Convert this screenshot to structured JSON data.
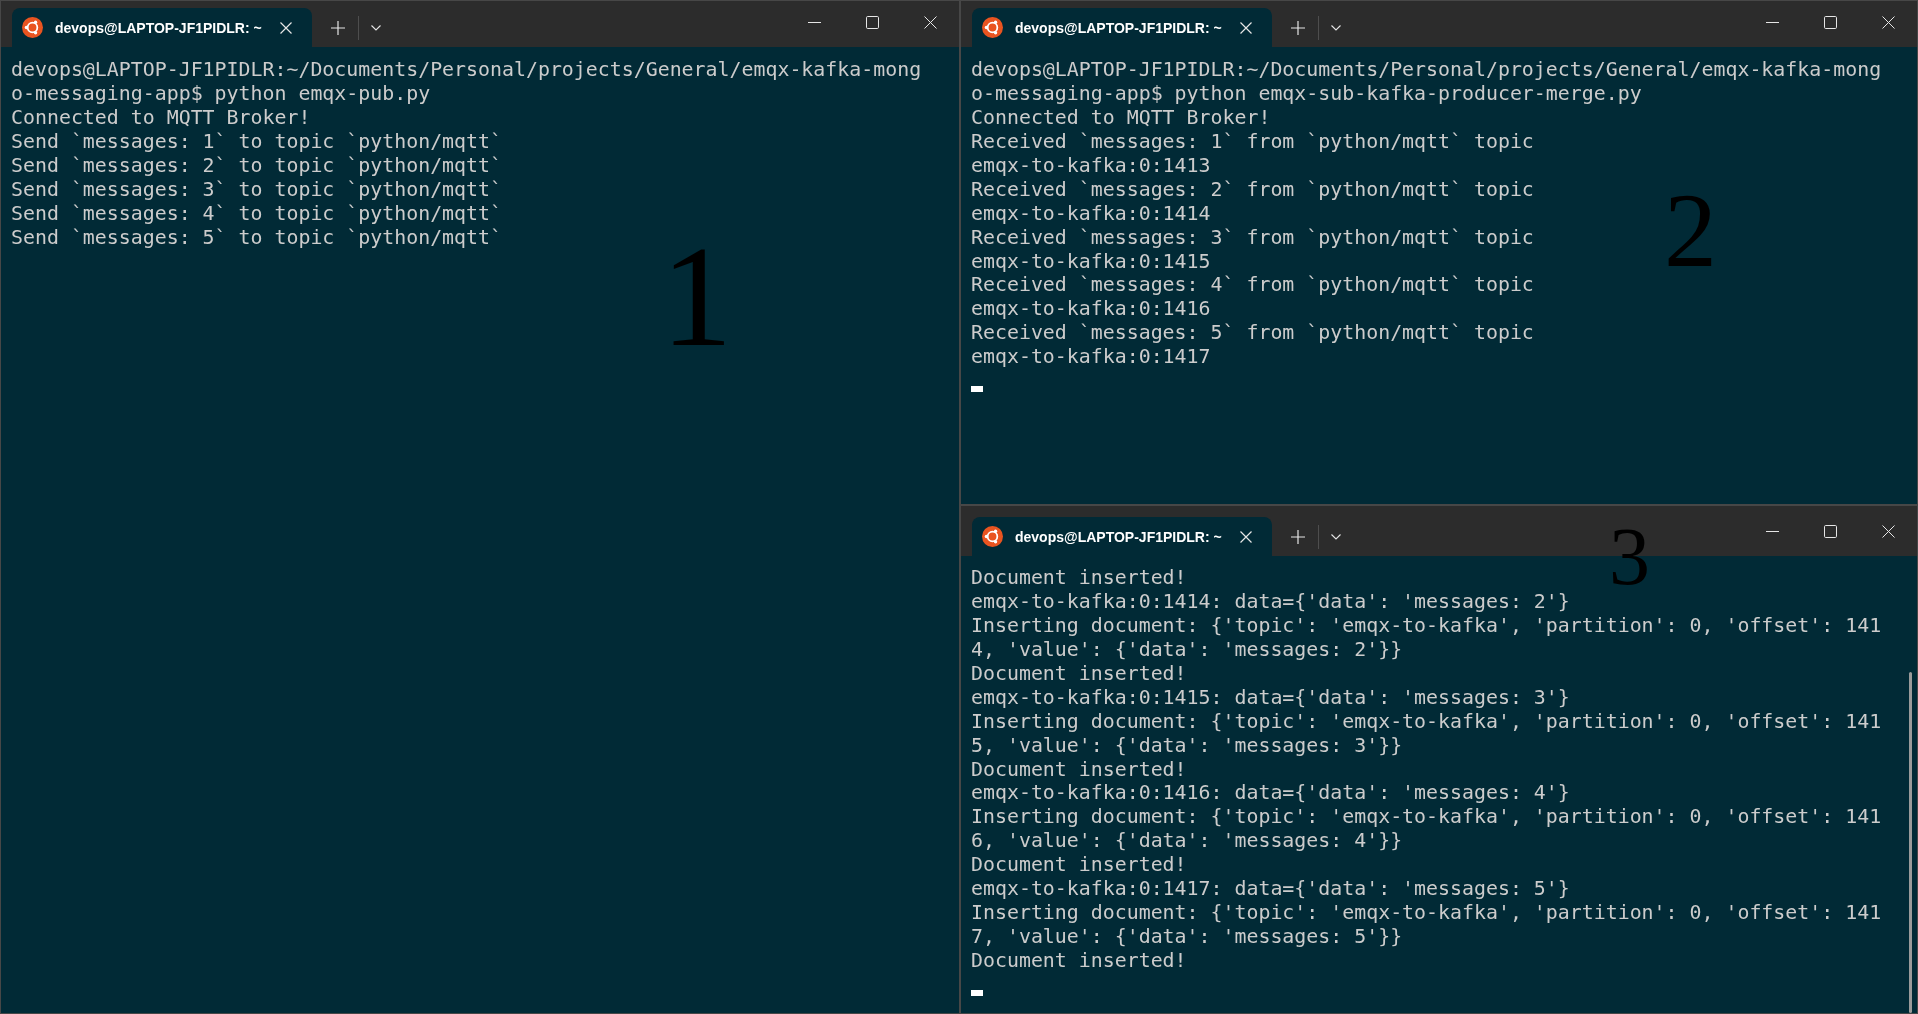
{
  "windows": [
    {
      "tab": {
        "title": "devops@LAPTOP-JF1PIDLR: ~",
        "selected": true
      },
      "lines": [
        "devops@LAPTOP-JF1PIDLR:~/Documents/Personal/projects/General/emqx-kafka-mong",
        "o-messaging-app$ python emqx-pub.py",
        "Connected to MQTT Broker!",
        "Send `messages: 1` to topic `python/mqtt`",
        "Send `messages: 2` to topic `python/mqtt`",
        "Send `messages: 3` to topic `python/mqtt`",
        "Send `messages: 4` to topic `python/mqtt`",
        "Send `messages: 5` to topic `python/mqtt`"
      ],
      "cursor": false,
      "scrollbar": false,
      "annotation": "1"
    },
    {
      "tab": {
        "title": "devops@LAPTOP-JF1PIDLR: ~",
        "selected": true
      },
      "lines": [
        "devops@LAPTOP-JF1PIDLR:~/Documents/Personal/projects/General/emqx-kafka-mong",
        "o-messaging-app$ python emqx-sub-kafka-producer-merge.py",
        "Connected to MQTT Broker!",
        "Received `messages: 1` from `python/mqtt` topic",
        "emqx-to-kafka:0:1413",
        "Received `messages: 2` from `python/mqtt` topic",
        "emqx-to-kafka:0:1414",
        "Received `messages: 3` from `python/mqtt` topic",
        "emqx-to-kafka:0:1415",
        "Received `messages: 4` from `python/mqtt` topic",
        "emqx-to-kafka:0:1416",
        "Received `messages: 5` from `python/mqtt` topic",
        "emqx-to-kafka:0:1417"
      ],
      "cursor": true,
      "scrollbar": false,
      "annotation": "2"
    },
    {
      "tab": {
        "title": "devops@LAPTOP-JF1PIDLR: ~",
        "selected": true
      },
      "lines": [
        "Document inserted!",
        "emqx-to-kafka:0:1414: data={'data': 'messages: 2'}",
        "Inserting document: {'topic': 'emqx-to-kafka', 'partition': 0, 'offset': 141",
        "4, 'value': {'data': 'messages: 2'}}",
        "Document inserted!",
        "emqx-to-kafka:0:1415: data={'data': 'messages: 3'}",
        "Inserting document: {'topic': 'emqx-to-kafka', 'partition': 0, 'offset': 141",
        "5, 'value': {'data': 'messages: 3'}}",
        "Document inserted!",
        "emqx-to-kafka:0:1416: data={'data': 'messages: 4'}",
        "Inserting document: {'topic': 'emqx-to-kafka', 'partition': 0, 'offset': 141",
        "6, 'value': {'data': 'messages: 4'}}",
        "Document inserted!",
        "emqx-to-kafka:0:1417: data={'data': 'messages: 5'}",
        "Inserting document: {'topic': 'emqx-to-kafka', 'partition': 0, 'offset': 141",
        "7, 'value': {'data': 'messages: 5'}}",
        "Document inserted!"
      ],
      "cursor": true,
      "scrollbar": true,
      "annotation": "3"
    }
  ]
}
